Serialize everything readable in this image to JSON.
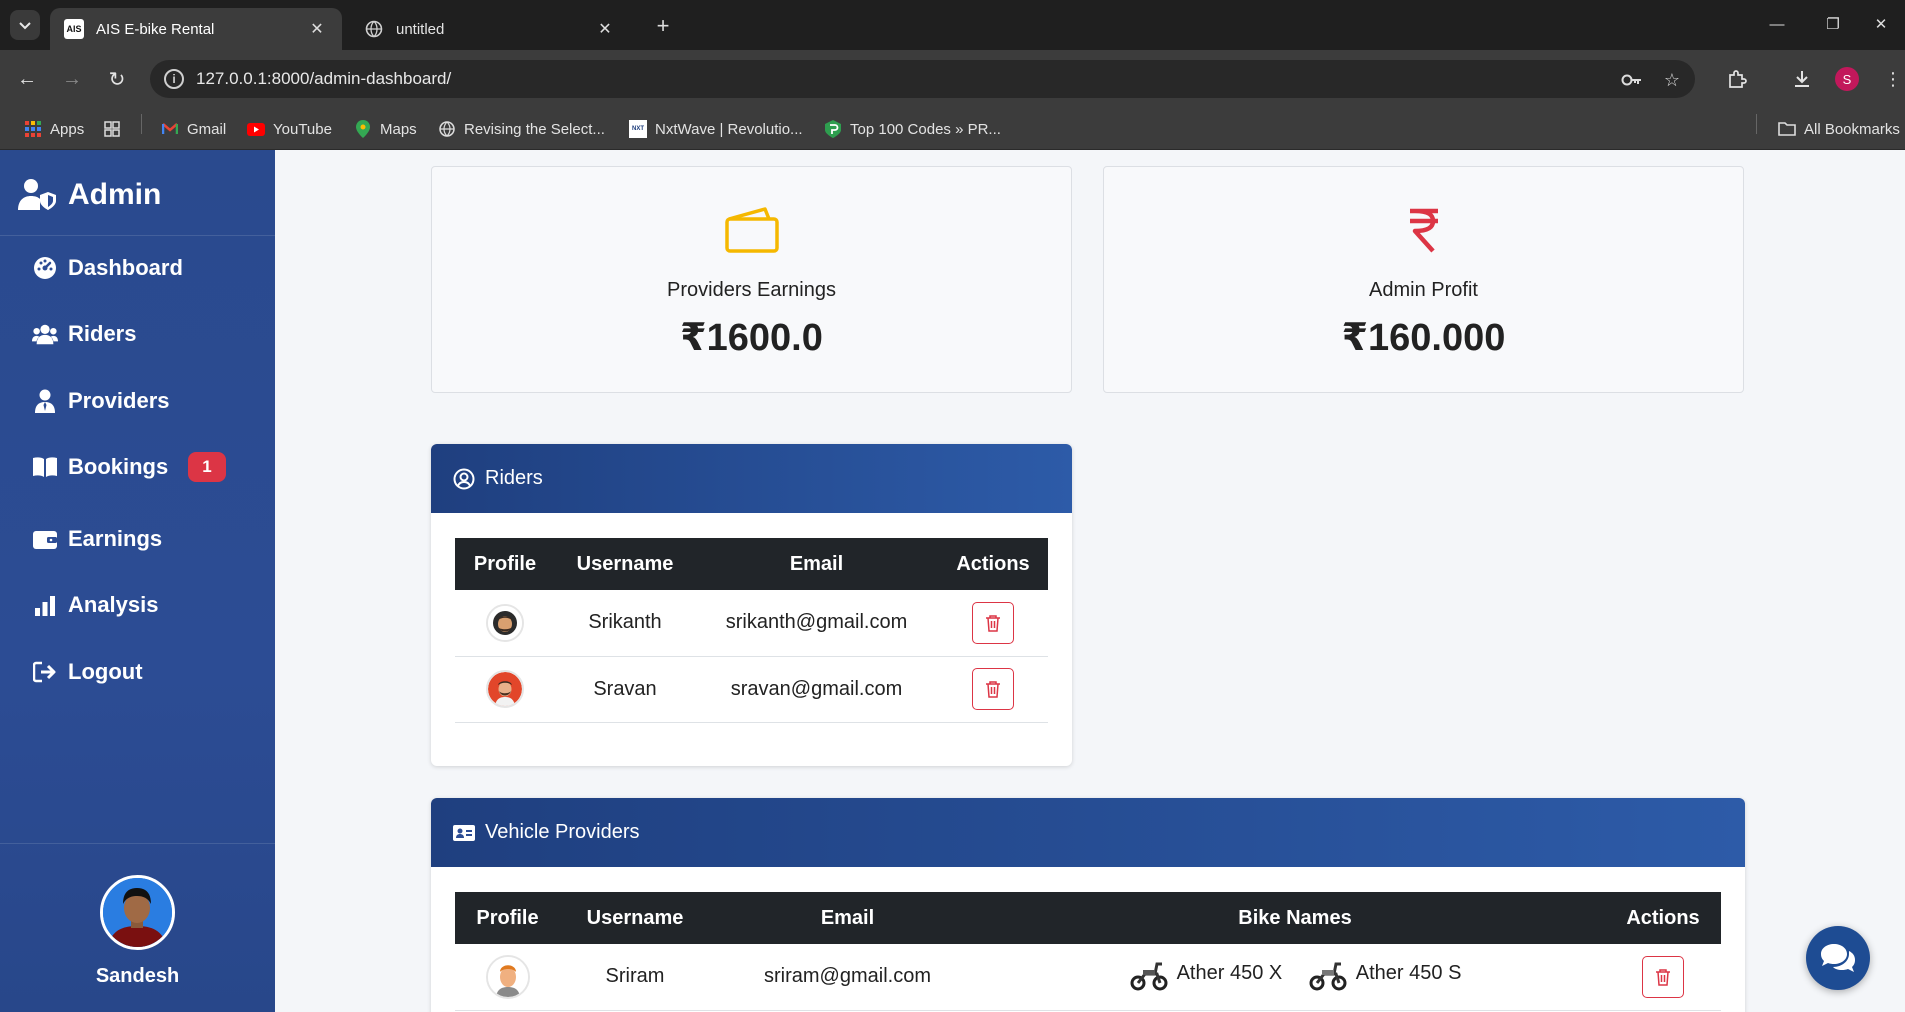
{
  "browser": {
    "tabs": [
      {
        "title": "AIS E-bike Rental",
        "favicon": "AIS",
        "active": true
      },
      {
        "title": "untitled",
        "favicon": "globe-icon",
        "active": false
      }
    ],
    "url": "127.0.0.1:8000/admin-dashboard/",
    "profile_initial": "S",
    "bookmarks": [
      {
        "label": "Apps",
        "icon": "apps-grid-icon"
      },
      {
        "label": "",
        "icon": "grid-icon"
      },
      {
        "label": "Gmail",
        "icon": "gmail-icon"
      },
      {
        "label": "YouTube",
        "icon": "youtube-icon"
      },
      {
        "label": "Maps",
        "icon": "maps-icon"
      },
      {
        "label": "Revising the Select...",
        "icon": "globe-icon"
      },
      {
        "label": "NxtWave | Revolutio...",
        "icon": "nxtwave-icon"
      },
      {
        "label": "Top 100 Codes » PR...",
        "icon": "shield-icon"
      }
    ],
    "all_bookmarks": "All Bookmarks"
  },
  "sidebar": {
    "brand": "Admin",
    "items": [
      {
        "label": "Dashboard",
        "icon": "dashboard-gauge-icon"
      },
      {
        "label": "Riders",
        "icon": "users-icon"
      },
      {
        "label": "Providers",
        "icon": "user-tie-icon"
      },
      {
        "label": "Bookings",
        "icon": "book-icon",
        "badge": "1"
      },
      {
        "label": "Earnings",
        "icon": "wallet-icon"
      },
      {
        "label": "Analysis",
        "icon": "bar-chart-icon"
      },
      {
        "label": "Logout",
        "icon": "logout-icon"
      }
    ],
    "user": {
      "name": "Sandesh"
    }
  },
  "stats": {
    "providers": {
      "label": "Providers Earnings",
      "value": "₹1600.0",
      "icon": "wallet-icon",
      "color": "#f5b800"
    },
    "admin": {
      "label": "Admin Profit",
      "value": "₹160.000",
      "icon": "rupee-icon",
      "color": "#dc3545"
    }
  },
  "riders_panel": {
    "title": "Riders",
    "columns": [
      "Profile",
      "Username",
      "Email",
      "Actions"
    ],
    "rows": [
      {
        "username": "Srikanth",
        "email": "srikanth@gmail.com"
      },
      {
        "username": "Sravan",
        "email": "sravan@gmail.com"
      }
    ]
  },
  "providers_panel": {
    "title": "Vehicle Providers",
    "columns": [
      "Profile",
      "Username",
      "Email",
      "Bike Names",
      "Actions"
    ],
    "rows": [
      {
        "username": "Sriram",
        "email": "sriram@gmail.com",
        "bikes": [
          "Ather 450 X",
          "Ather 450 S"
        ]
      }
    ]
  },
  "colors": {
    "sidebar": "#2c4c94",
    "header_dark": "#212529",
    "danger": "#dc3545"
  }
}
